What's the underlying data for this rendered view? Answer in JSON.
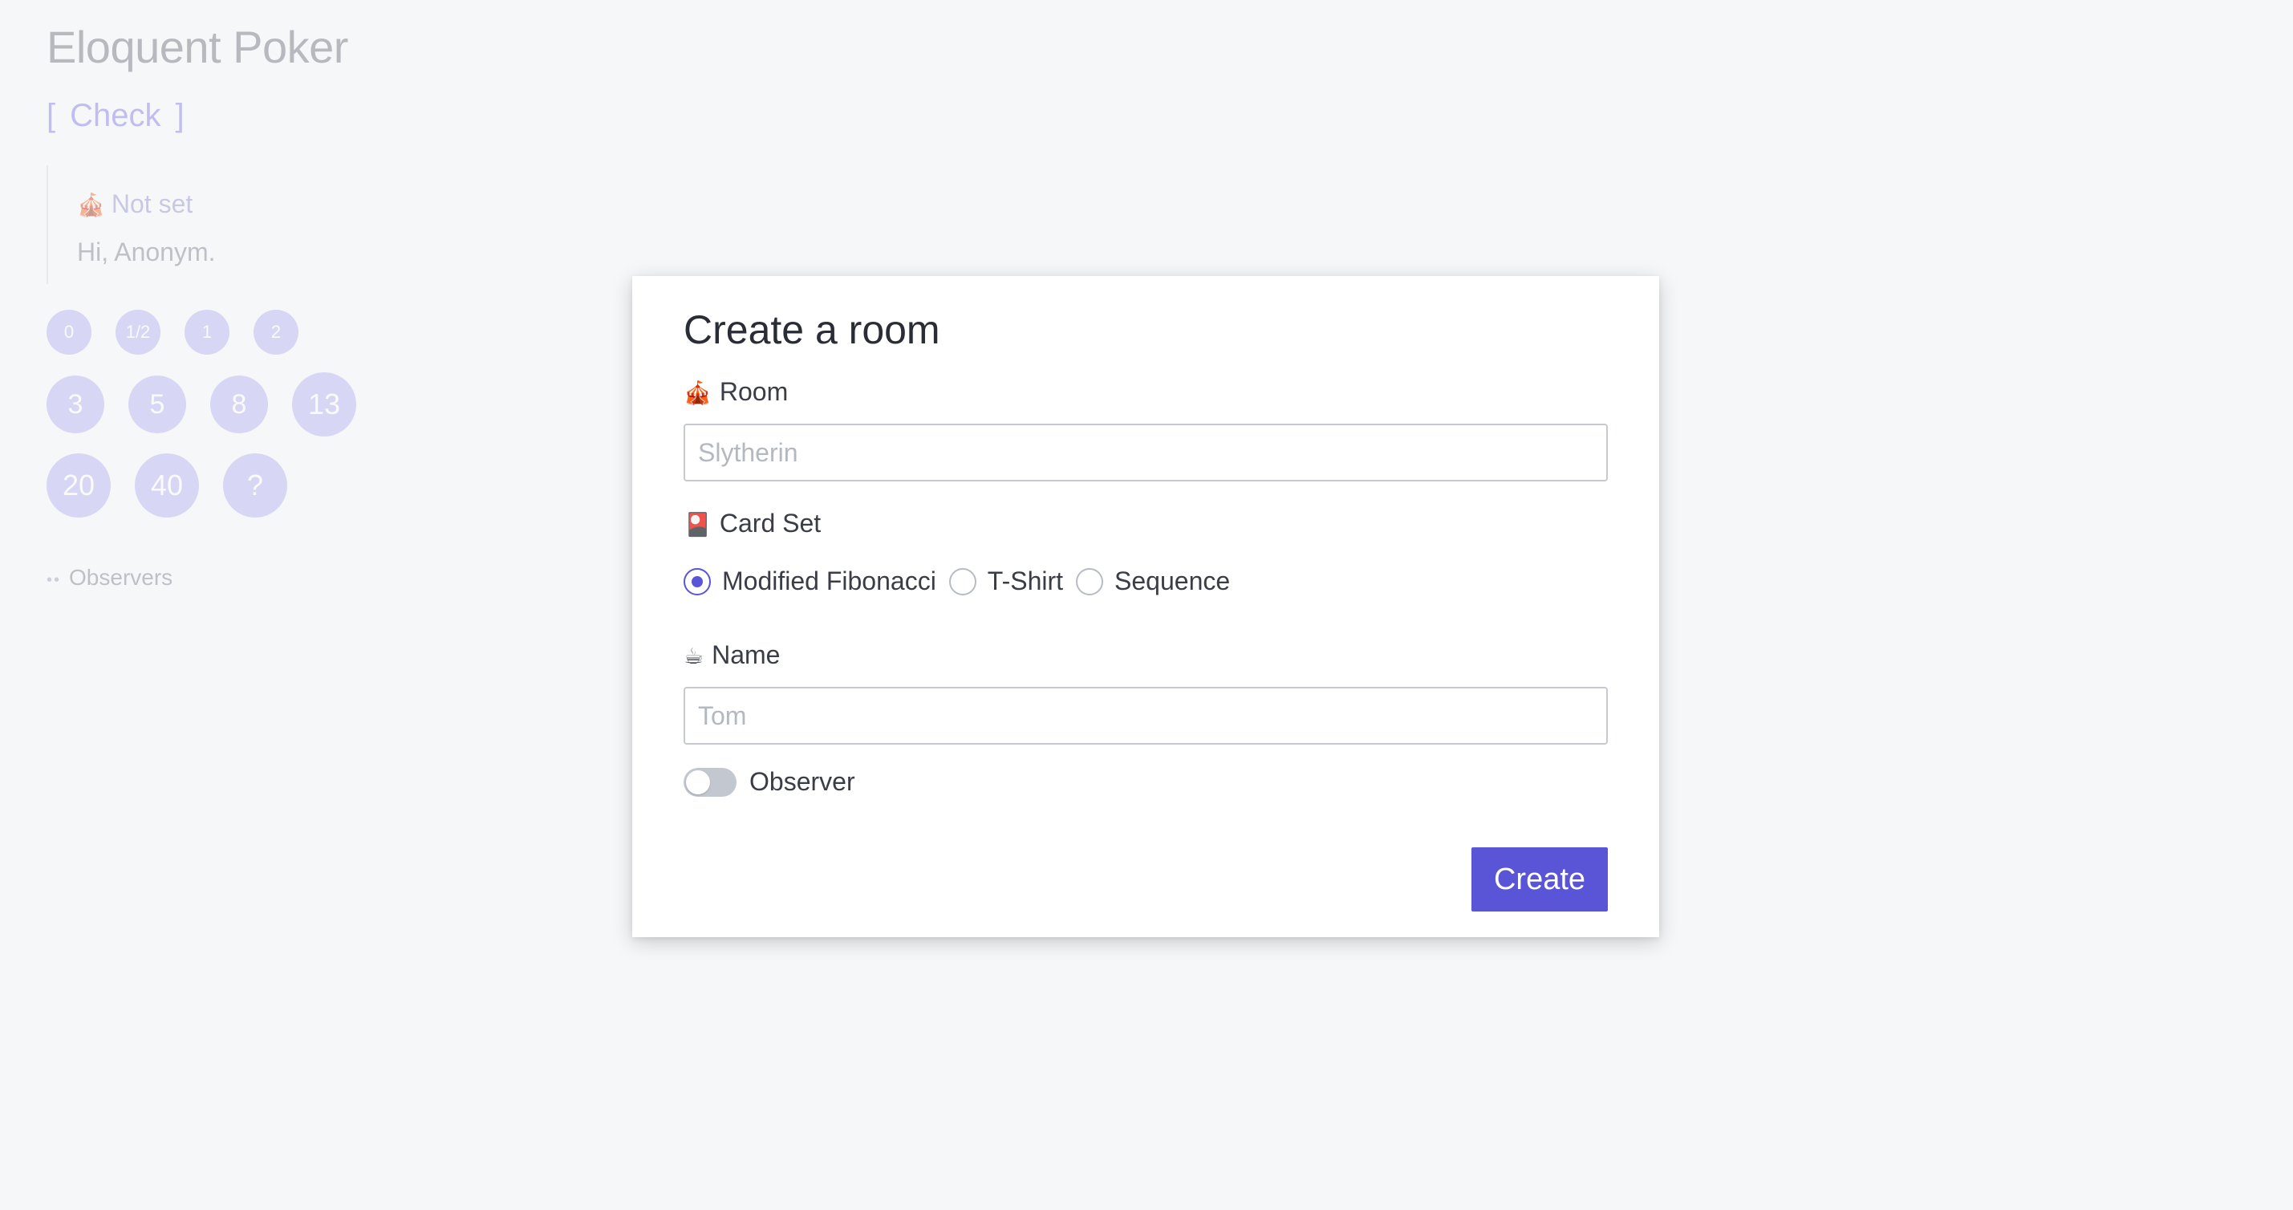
{
  "app": {
    "title": "Eloquent Poker",
    "check_label": "Check",
    "bracket_open": "[",
    "bracket_close": "]"
  },
  "info": {
    "room_icon": "circus-tent-icon",
    "room_icon_glyph": "🎪",
    "room_value": "Not set",
    "greeting": "Hi, Anonym."
  },
  "cards": [
    "0",
    "1/2",
    "1",
    "2",
    "3",
    "5",
    "8",
    "13",
    "20",
    "40",
    "?"
  ],
  "observers": {
    "icon": "eyes-icon",
    "icon_glyph": "••",
    "label": "Observers"
  },
  "modal": {
    "title": "Create a room",
    "room_label": "Room",
    "room_icon": "circus-tent-icon",
    "room_icon_glyph": "🎪",
    "room_placeholder": "Slytherin",
    "card_set_label": "Card Set",
    "card_set_icon": "playing-card-icon",
    "card_set_icon_glyph": "🎴",
    "card_set_options": [
      "Modified Fibonacci",
      "T-Shirt",
      "Sequence"
    ],
    "card_set_selected": "Modified Fibonacci",
    "name_label": "Name",
    "name_icon": "coffee-icon",
    "name_icon_glyph": "☕",
    "name_placeholder": "Tom",
    "observer_label": "Observer",
    "observer_on": false,
    "create_label": "Create"
  },
  "colors": {
    "accent": "#5a54d6",
    "card": "#b2aff0",
    "background": "#f6f7f9"
  }
}
